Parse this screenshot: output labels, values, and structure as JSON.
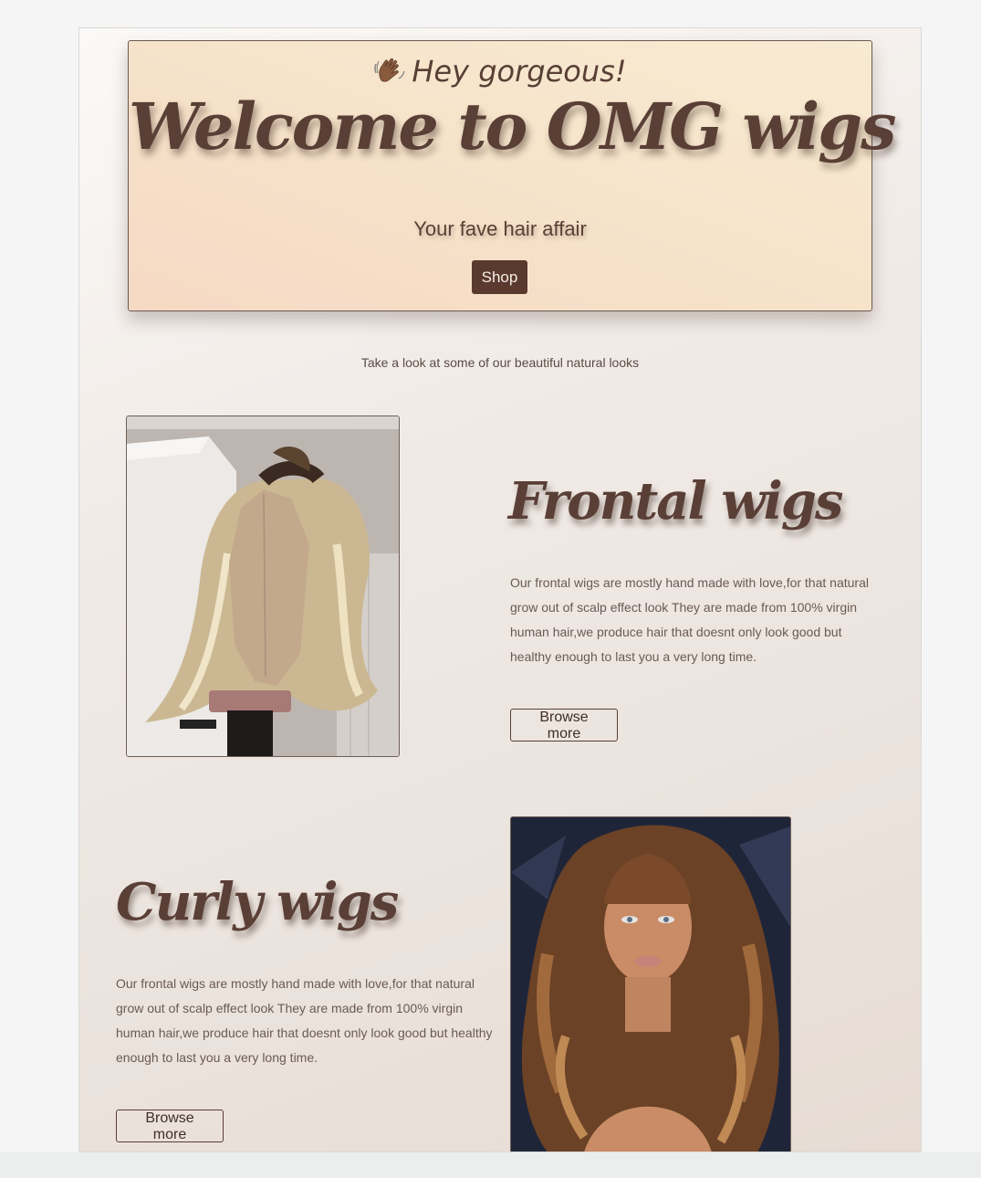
{
  "hero": {
    "greeting": "Hey gorgeous!",
    "title": "Welcome to OMG wigs",
    "subtitle": "Your fave hair affair",
    "shop_label": "Shop"
  },
  "tagline": "Take a look at some of our beautiful natural looks",
  "sections": [
    {
      "title": "Frontal wigs",
      "text": "Our frontal wigs are mostly hand made with love,for that natural grow out of scalp effect look They are made from 100% virgin human hair,we produce hair that doesnt only look good but healthy enough to last you a very long time.",
      "button_label": "Browse more",
      "image": "frontal-wig-on-mannequin"
    },
    {
      "title": "Curly wigs",
      "text": "Our frontal wigs are mostly hand made with love,for that natural grow out of scalp effect look They are made from 100% virgin human hair,we produce hair that doesnt only look good but healthy enough to last you a very long time.",
      "button_label": "Browse more",
      "image": "curly-wig-model"
    }
  ],
  "colors": {
    "accent": "#5a3a2e",
    "heading": "#5a3f36",
    "hero_bg": "#f6e2c9"
  },
  "icons": {
    "greeting_icon": "waving-hand-icon"
  }
}
